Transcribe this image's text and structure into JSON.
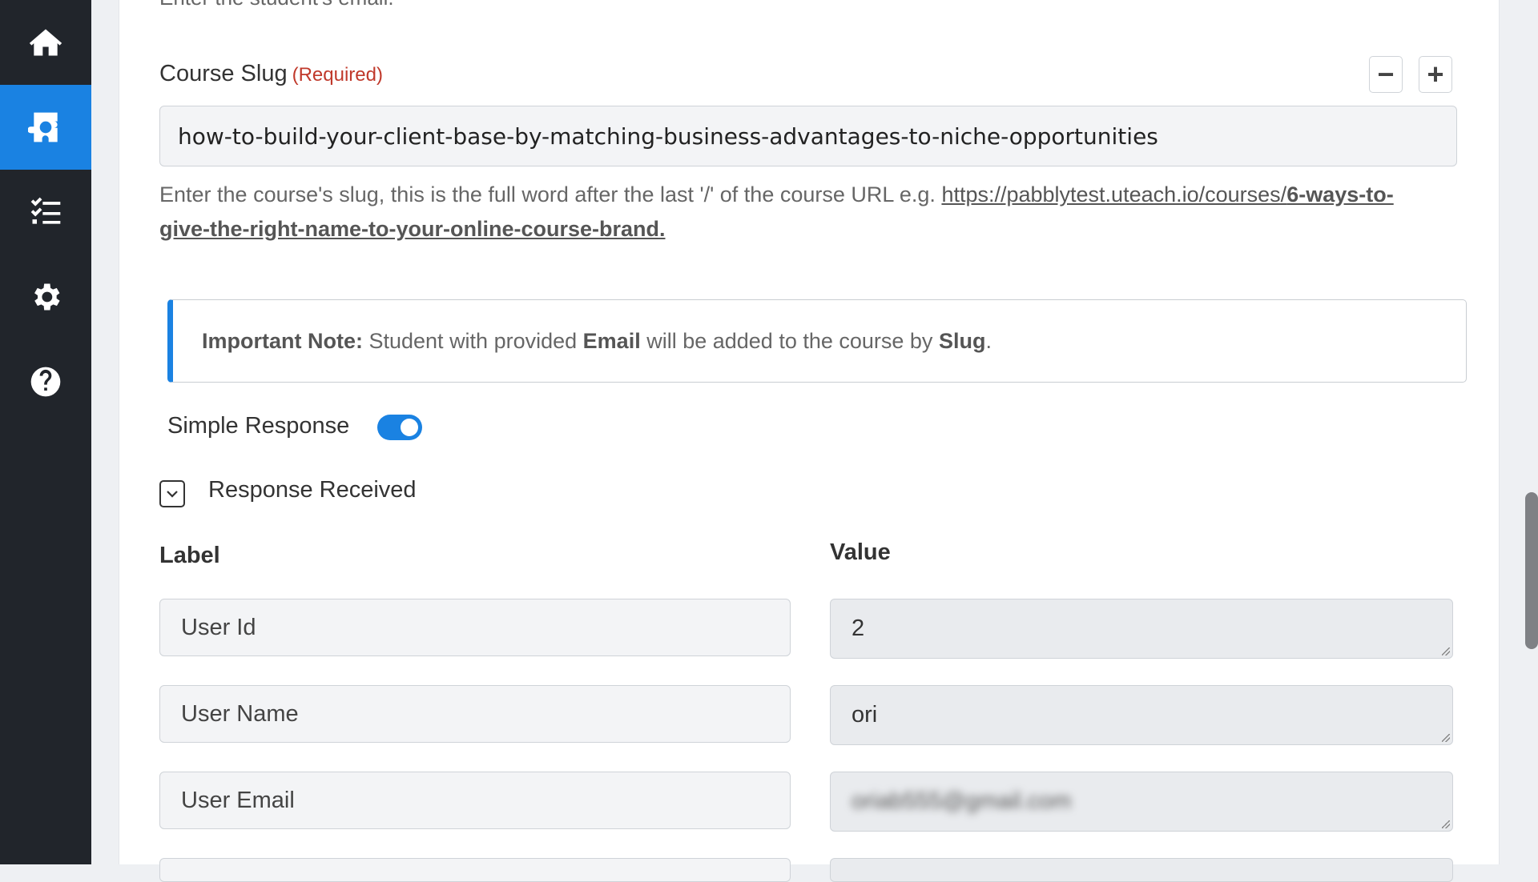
{
  "sidebar": {
    "items": [
      {
        "icon": "home-icon",
        "active": false
      },
      {
        "icon": "integration-icon",
        "active": true
      },
      {
        "icon": "task-list-icon",
        "active": false
      },
      {
        "icon": "gear-icon",
        "active": false
      },
      {
        "icon": "help-icon",
        "active": false
      }
    ]
  },
  "form": {
    "prev_helper": "Enter the student's email.",
    "course_slug": {
      "label": "Course Slug",
      "required": "(Required)",
      "value": "how-to-build-your-client-base-by-matching-business-advantages-to-niche-opportunities",
      "helper_prefix": "Enter the course's slug, this is the full word after the last '/' of the course URL e.g. ",
      "helper_link": "https://pabblytest.uteach.io/courses/",
      "helper_link_bold": "6-ways-to-give-the-right-name-to-your-online-course-brand.",
      "minus_label": "−",
      "plus_label": "+"
    },
    "note": {
      "title": "Important Note:",
      "text1": " Student with provided ",
      "bold1": "Email",
      "text2": " will be added to the course by ",
      "bold2": "Slug",
      "text3": "."
    },
    "simple_response": {
      "label": "Simple Response",
      "enabled": true
    },
    "response_received": {
      "label": "Response Received"
    },
    "table": {
      "label_header": "Label",
      "value_header": "Value",
      "rows": [
        {
          "label": "User Id",
          "value": "2"
        },
        {
          "label": "User Name",
          "value": "ori"
        },
        {
          "label": "User Email",
          "value": "oriab555@gmail.com"
        }
      ]
    }
  },
  "colors": {
    "accent": "#1a82e2",
    "sidebar_bg": "#21252b",
    "required": "#c0392b"
  }
}
